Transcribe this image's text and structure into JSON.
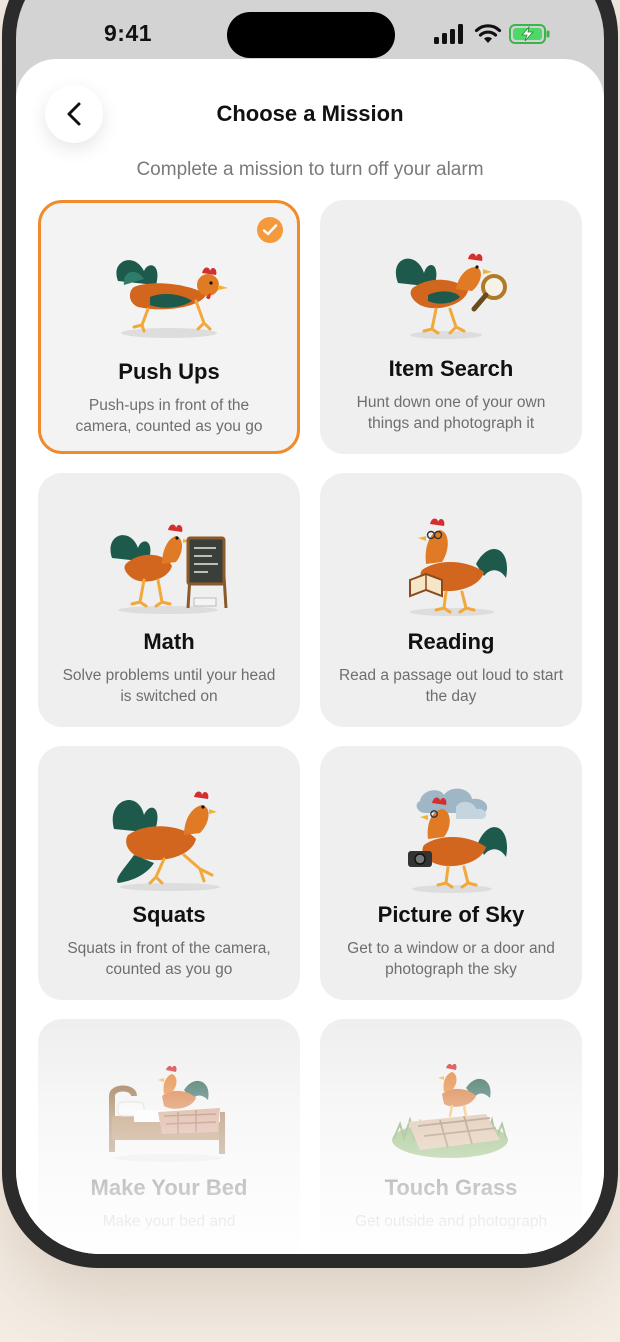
{
  "status_bar": {
    "time": "9:41"
  },
  "header": {
    "title": "Choose a Mission",
    "subtitle": "Complete a mission to turn off your alarm"
  },
  "colors": {
    "accent": "#f08a2a",
    "card_bg": "#efefef"
  },
  "missions": [
    {
      "name": "Push Ups",
      "desc": "Push-ups in front of the camera, counted as you go",
      "icon": "rooster-pushup-icon",
      "selected": true
    },
    {
      "name": "Item Search",
      "desc": "Hunt down one of your own things and photograph it",
      "icon": "rooster-magnifier-icon",
      "selected": false
    },
    {
      "name": "Math",
      "desc": "Solve problems until your head is switched on",
      "icon": "rooster-chalkboard-icon",
      "selected": false
    },
    {
      "name": "Reading",
      "desc": "Read a passage out loud to start the day",
      "icon": "rooster-book-icon",
      "selected": false
    },
    {
      "name": "Squats",
      "desc": "Squats in front of the camera, counted as you go",
      "icon": "rooster-squat-icon",
      "selected": false
    },
    {
      "name": "Picture of Sky",
      "desc": "Get to a window or a door and photograph the sky",
      "icon": "rooster-camera-sky-icon",
      "selected": false
    },
    {
      "name": "Make Your Bed",
      "desc": "Make your bed and",
      "icon": "rooster-bed-icon",
      "selected": false
    },
    {
      "name": "Touch Grass",
      "desc": "Get outside and photograph",
      "icon": "rooster-grass-icon",
      "selected": false
    }
  ]
}
